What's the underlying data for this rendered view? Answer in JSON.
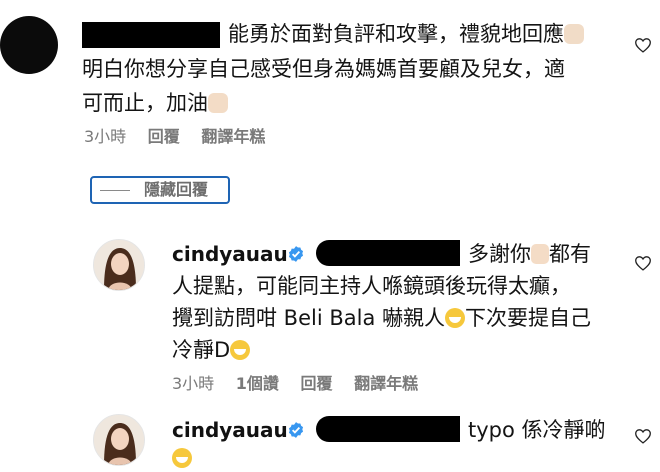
{
  "comment_1": {
    "lines": [
      "能勇於面對負評和攻擊，禮貌地回應",
      "明白你想分享自己感受但身為媽媽首要顧及兒女，適",
      "可而止，加油"
    ],
    "meta": {
      "time": "3小時",
      "reply": "回覆",
      "translate": "翻譯年糕"
    },
    "hide_replies": "隱藏回覆"
  },
  "reply_1": {
    "username": "cindyauau",
    "lines": [
      "多謝你",
      "都有",
      "人提點，可能同主持人喺鏡頭後玩得太癲，",
      "攪到訪問咁 Beli Bala 嚇親人",
      "下次要提自己",
      "冷靜D"
    ],
    "meta": {
      "time": "3小時",
      "likes": "1個讚",
      "reply": "回覆",
      "translate": "翻譯年糕"
    }
  },
  "reply_2": {
    "username": "cindyauau",
    "lines": [
      "typo 係冷靜啲"
    ]
  },
  "icons": {
    "like": "heart-outline-icon",
    "verified": "verified-badge-icon",
    "brand_blue": "#3897f0"
  }
}
